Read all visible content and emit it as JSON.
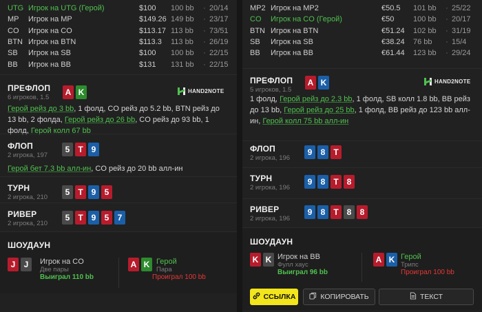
{
  "left": {
    "players": [
      {
        "pos": "UTG",
        "name": "Игрок на UTG (Герой)",
        "amount": "$100",
        "bb": "100 bb",
        "ratio": "20/14",
        "hero": true
      },
      {
        "pos": "MP",
        "name": "Игрок на MP",
        "amount": "$149.26",
        "bb": "149 bb",
        "ratio": "23/17",
        "hero": false
      },
      {
        "pos": "CO",
        "name": "Игрок на CO",
        "amount": "$113.17",
        "bb": "113 bb",
        "ratio": "73/51",
        "hero": false
      },
      {
        "pos": "BTN",
        "name": "Игрок на BTN",
        "amount": "$113.3",
        "bb": "113 bb",
        "ratio": "26/19",
        "hero": false
      },
      {
        "pos": "SB",
        "name": "Игрок на SB",
        "amount": "$100",
        "bb": "100 bb",
        "ratio": "22/15",
        "hero": false
      },
      {
        "pos": "BB",
        "name": "Игрок на BB",
        "amount": "$131",
        "bb": "131 bb",
        "ratio": "22/15",
        "hero": false
      }
    ],
    "preflop": {
      "title": "ПРЕФЛОП",
      "sub": "6 игроков, 1.5",
      "cards": [
        {
          "r": "A",
          "c": "red"
        },
        {
          "r": "K",
          "c": "green"
        }
      ],
      "actions": [
        {
          "t": "Герой рейз до 3 bb",
          "hero": true
        },
        {
          "t": ", 1 фолд, CO ",
          "hero": false
        },
        {
          "t": "рейз до 5.2 bb",
          "hero": false
        },
        {
          "t": ", BTN рейз до 13 bb, 2 фолда, ",
          "hero": false
        },
        {
          "t": "Герой рейз до 26 bb",
          "hero": true
        },
        {
          "t": ", CO рейз до 93 bb, 1 фолд, ",
          "hero": false
        },
        {
          "t": "Герой колл 67 bb",
          "hero": true
        }
      ]
    },
    "flop": {
      "title": "ФЛОП",
      "sub": "2 игрока, 197",
      "cards": [
        {
          "r": "5",
          "c": "gray"
        },
        {
          "r": "T",
          "c": "red"
        },
        {
          "r": "9",
          "c": "blue"
        }
      ],
      "actions": [
        {
          "t": "Герой бет 7.3 bb алл-ин",
          "hero": true
        },
        {
          "t": ", CO рейз до 20 bb алл-ин",
          "hero": false
        }
      ]
    },
    "turn": {
      "title": "ТУРН",
      "sub": "2 игрока, 210",
      "cards": [
        {
          "r": "5",
          "c": "gray"
        },
        {
          "r": "T",
          "c": "red"
        },
        {
          "r": "9",
          "c": "blue"
        },
        {
          "r": "5",
          "c": "red"
        }
      ]
    },
    "river": {
      "title": "РИВЕР",
      "sub": "2 игрока, 210",
      "cards": [
        {
          "r": "5",
          "c": "gray"
        },
        {
          "r": "T",
          "c": "red"
        },
        {
          "r": "9",
          "c": "blue"
        },
        {
          "r": "5",
          "c": "red"
        },
        {
          "r": "7",
          "c": "blue"
        }
      ]
    },
    "showdown": {
      "title": "ШОУДАУН",
      "p1": {
        "cards": [
          {
            "r": "J",
            "c": "red"
          },
          {
            "r": "J",
            "c": "gray"
          }
        ],
        "name": "Игрок на CO",
        "hand": "Две пары",
        "result": "Выиграл 110 bb",
        "won": true
      },
      "p2": {
        "cards": [
          {
            "r": "A",
            "c": "red"
          },
          {
            "r": "K",
            "c": "green"
          }
        ],
        "name": "Герой",
        "hand": "Пара",
        "result": "Проиграл 100 bb",
        "won": false
      }
    }
  },
  "right": {
    "players": [
      {
        "pos": "MP2",
        "name": "Игрок на MP2",
        "amount": "€50.5",
        "bb": "101 bb",
        "ratio": "25/22",
        "hero": false
      },
      {
        "pos": "CO",
        "name": "Игрок на CO (Герой)",
        "amount": "€50",
        "bb": "100 bb",
        "ratio": "20/17",
        "hero": true
      },
      {
        "pos": "BTN",
        "name": "Игрок на BTN",
        "amount": "€51.24",
        "bb": "102 bb",
        "ratio": "31/19",
        "hero": false
      },
      {
        "pos": "SB",
        "name": "Игрок на SB",
        "amount": "€38.24",
        "bb": "76 bb",
        "ratio": "15/4",
        "hero": false
      },
      {
        "pos": "BB",
        "name": "Игрок на BB",
        "amount": "€61.44",
        "bb": "123 bb",
        "ratio": "29/24",
        "hero": false
      }
    ],
    "preflop": {
      "title": "ПРЕФЛОП",
      "sub": "5 игроков, 1.5",
      "cards": [
        {
          "r": "A",
          "c": "red"
        },
        {
          "r": "K",
          "c": "blue"
        }
      ],
      "actions": [
        {
          "t": "1 фолд, ",
          "hero": false
        },
        {
          "t": "Герой рейз до 2.3 bb",
          "hero": true
        },
        {
          "t": ", 1 фолд, SB колл 1.8 bb, BB рейз до 13 bb, ",
          "hero": false
        },
        {
          "t": "Герой рейз до 25 bb",
          "hero": true
        },
        {
          "t": ", 1 фолд, BB рейз до 123 bb алл-ин, ",
          "hero": false
        },
        {
          "t": "Герой колл 75 bb алл-ин",
          "hero": true
        }
      ]
    },
    "flop": {
      "title": "ФЛОП",
      "sub": "2 игрока, 196",
      "cards": [
        {
          "r": "9",
          "c": "blue"
        },
        {
          "r": "8",
          "c": "blue"
        },
        {
          "r": "T",
          "c": "red"
        }
      ]
    },
    "turn": {
      "title": "ТУРН",
      "sub": "2 игрока, 196",
      "cards": [
        {
          "r": "9",
          "c": "blue"
        },
        {
          "r": "8",
          "c": "blue"
        },
        {
          "r": "T",
          "c": "red"
        },
        {
          "r": "8",
          "c": "red"
        }
      ]
    },
    "river": {
      "title": "РИВЕР",
      "sub": "2 игрока, 196",
      "cards": [
        {
          "r": "9",
          "c": "blue"
        },
        {
          "r": "8",
          "c": "blue"
        },
        {
          "r": "T",
          "c": "red"
        },
        {
          "r": "8",
          "c": "gray"
        },
        {
          "r": "8",
          "c": "red"
        }
      ]
    },
    "showdown": {
      "title": "ШОУДАУН",
      "p1": {
        "cards": [
          {
            "r": "K",
            "c": "red"
          },
          {
            "r": "K",
            "c": "gray"
          }
        ],
        "name": "Игрок на BB",
        "hand": "Фулл хаус",
        "result": "Выиграл 96 bb",
        "won": true
      },
      "p2": {
        "cards": [
          {
            "r": "A",
            "c": "red"
          },
          {
            "r": "K",
            "c": "blue"
          }
        ],
        "name": "Герой",
        "hand": "Трипс",
        "result": "Проиграл 100 bb",
        "won": false
      }
    },
    "buttons": {
      "link": "ССЫЛКА",
      "copy": "КОПИРОВАТЬ",
      "text": "ТЕКСТ"
    }
  },
  "logo_text": "HAND2NOTE",
  "colors": {
    "hero": "#4fc14f",
    "lost": "#e53935",
    "accent": "#f3e51b",
    "card_red": "#b71c2c",
    "card_green": "#2e8b2e",
    "card_blue": "#1b5fa8",
    "card_gray": "#4a4a4a"
  }
}
